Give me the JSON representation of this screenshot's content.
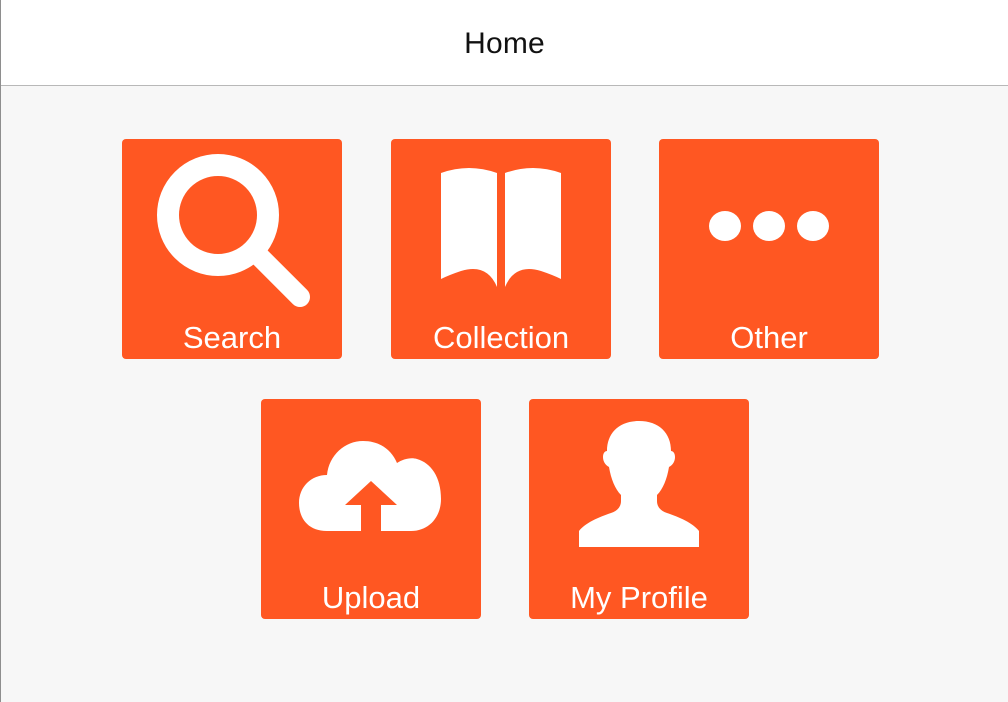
{
  "nav": {
    "title": "Home"
  },
  "theme": {
    "accent": "#ff5722",
    "background": "#f7f7f7",
    "nav_background": "#ffffff",
    "tile_text": "#ffffff"
  },
  "tiles": [
    {
      "label": "Search",
      "icon": "search-icon"
    },
    {
      "label": "Collection",
      "icon": "book-icon"
    },
    {
      "label": "Other",
      "icon": "more-icon"
    },
    {
      "label": "Upload",
      "icon": "cloud-upload-icon"
    },
    {
      "label": "My Profile",
      "icon": "user-icon"
    }
  ]
}
